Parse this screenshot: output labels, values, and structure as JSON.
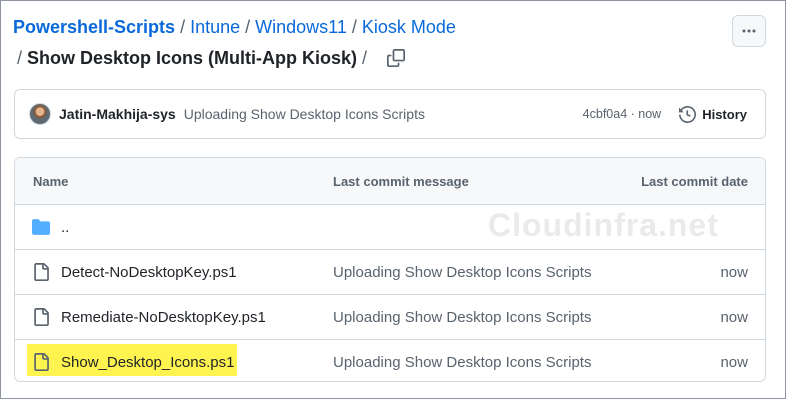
{
  "breadcrumb": {
    "root": "Powershell-Scripts",
    "parts": [
      "Intune",
      "Windows11",
      "Kiosk Mode"
    ],
    "current": "Show Desktop Icons (Multi-App Kiosk)",
    "separator": "/"
  },
  "commit": {
    "author": "Jatin-Makhija-sys",
    "message": "Uploading Show Desktop Icons Scripts",
    "sha": "4cbf0a4",
    "time": "now",
    "meta": "4cbf0a4 · now",
    "history_label": "History"
  },
  "table": {
    "headers": {
      "name": "Name",
      "message": "Last commit message",
      "date": "Last commit date"
    },
    "parent_dir": "..",
    "files": [
      {
        "name": "Detect-NoDesktopKey.ps1",
        "message": "Uploading Show Desktop Icons Scripts",
        "date": "now",
        "highlighted": false
      },
      {
        "name": "Remediate-NoDesktopKey.ps1",
        "message": "Uploading Show Desktop Icons Scripts",
        "date": "now",
        "highlighted": false
      },
      {
        "name": "Show_Desktop_Icons.ps1",
        "message": "Uploading Show Desktop Icons Scripts",
        "date": "now",
        "highlighted": true
      }
    ]
  },
  "watermark": "Cloudinfra.net",
  "colors": {
    "link": "#0969da",
    "highlight": "#fff44f",
    "folder": "#54aeff",
    "muted": "#59636e"
  },
  "icons": [
    "copy-icon",
    "kebab-horizontal-icon",
    "history-icon",
    "folder-icon",
    "file-icon"
  ]
}
